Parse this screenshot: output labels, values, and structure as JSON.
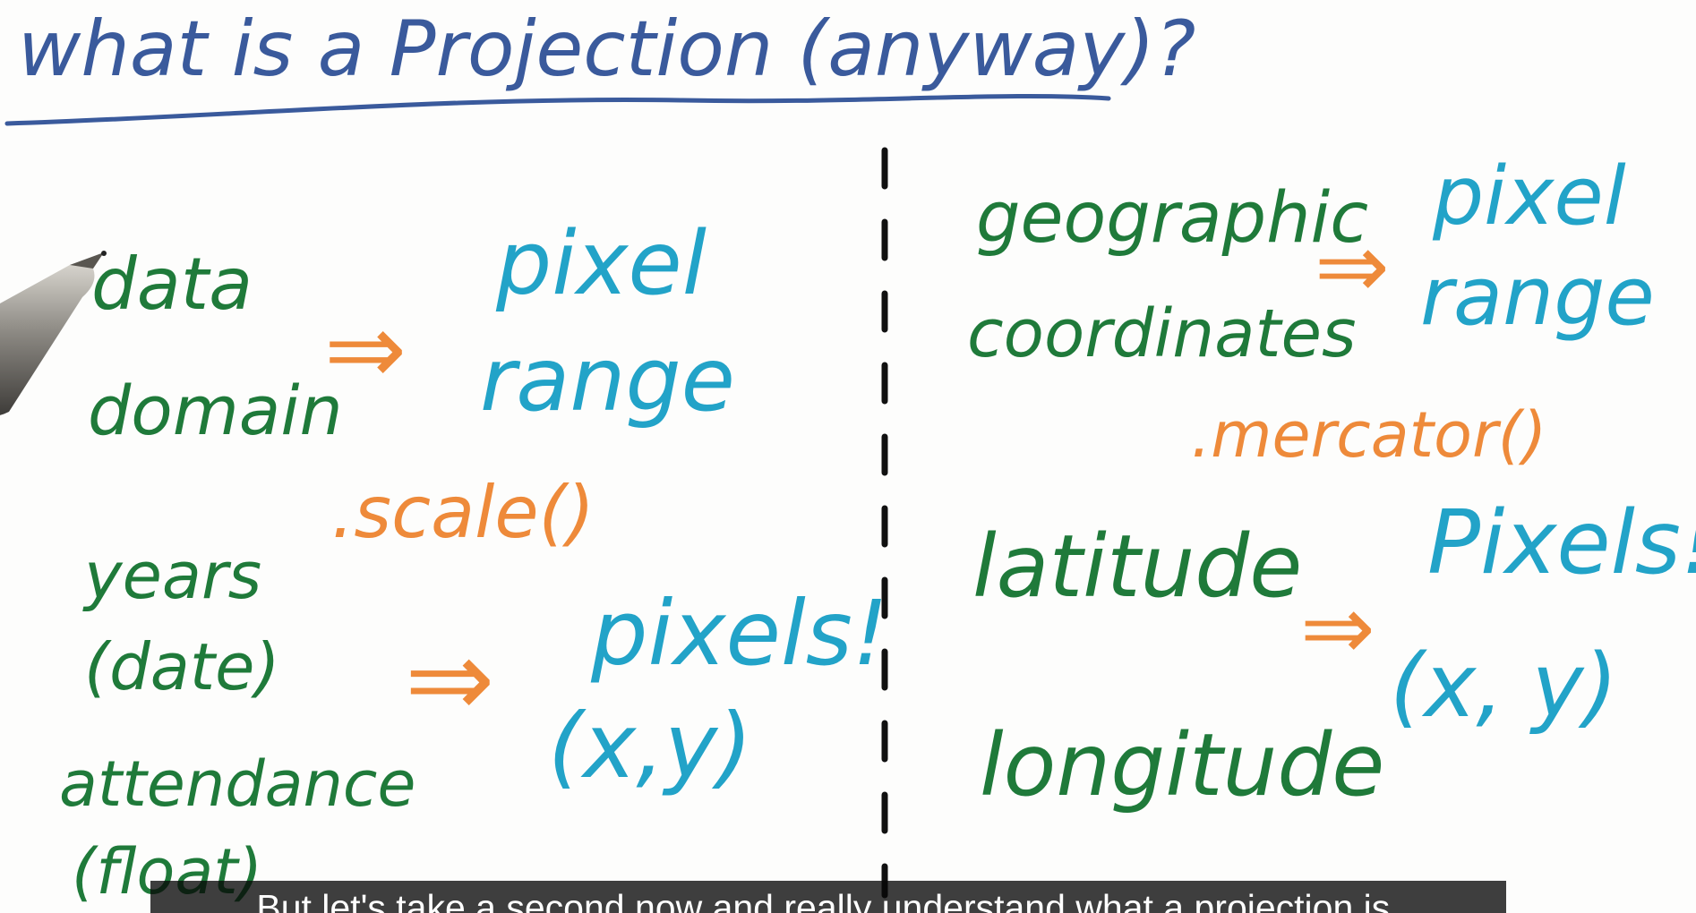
{
  "colors": {
    "title": "#3a5a9c",
    "source": "#1f7a3a",
    "arrow": "#ee8a3a",
    "target": "#22a3c8",
    "method": "#ee8a3a",
    "divider": "#111111",
    "caption_bg": "#080808"
  },
  "whiteboard": {
    "title": "what is a Projection (anyway)?",
    "left": {
      "source_line1": "data",
      "source_line2": "domain",
      "target_line1": "pixel",
      "target_line2": "range",
      "method": ".scale()",
      "example1_line1": "years",
      "example1_line2": "(date)",
      "example2_line1": "attendance",
      "example2_line2": "(float)",
      "result_line1": "pixels!",
      "result_line2": "(x,y)"
    },
    "right": {
      "source_line1": "geographic",
      "source_line2": "coordinates",
      "target_line1": "pixel",
      "target_line2": "range",
      "method": ".mercator()",
      "example1": "latitude",
      "example2": "longitude",
      "result_line1": "Pixels!",
      "result_line2": "(x, y)"
    },
    "arrow_glyph": "⇒",
    "pen_icon": "pen-icon"
  },
  "caption": {
    "text": "But let's take a second now and really understand what a projection is."
  }
}
